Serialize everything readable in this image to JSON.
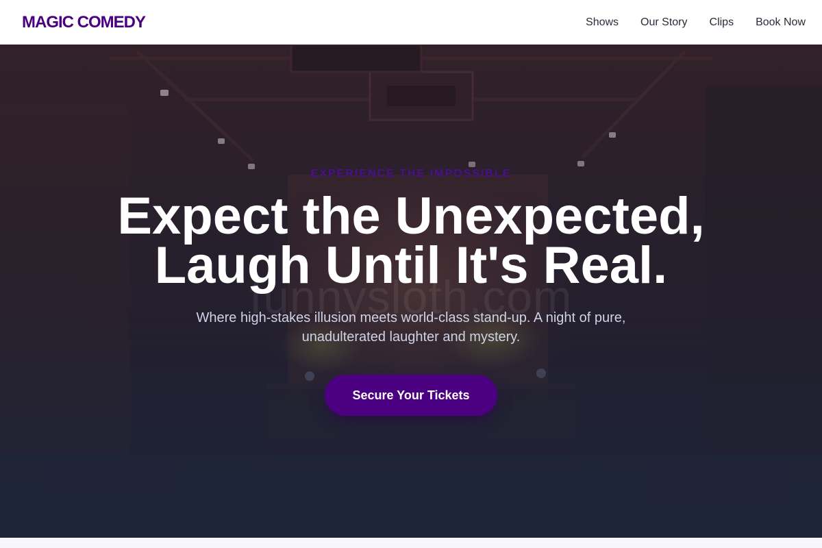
{
  "brand": {
    "logo": "MAGIC COMEDY",
    "accent_color": "#4b0082"
  },
  "nav": {
    "items": [
      {
        "label": "Shows"
      },
      {
        "label": "Our Story"
      },
      {
        "label": "Clips"
      },
      {
        "label": "Book Now"
      }
    ]
  },
  "hero": {
    "eyebrow": "EXPERIENCE THE IMPOSSIBLE",
    "headline": "Expect the Unexpected, Laugh Until It's Real.",
    "subhead": "Where high-stakes illusion meets world-class stand-up. A night of pure, unadulterated laughter and mystery.",
    "cta_label": "Secure Your Tickets",
    "watermark": "funnysloth.com",
    "background_image": "dark-comedy-club-stage-photo"
  }
}
